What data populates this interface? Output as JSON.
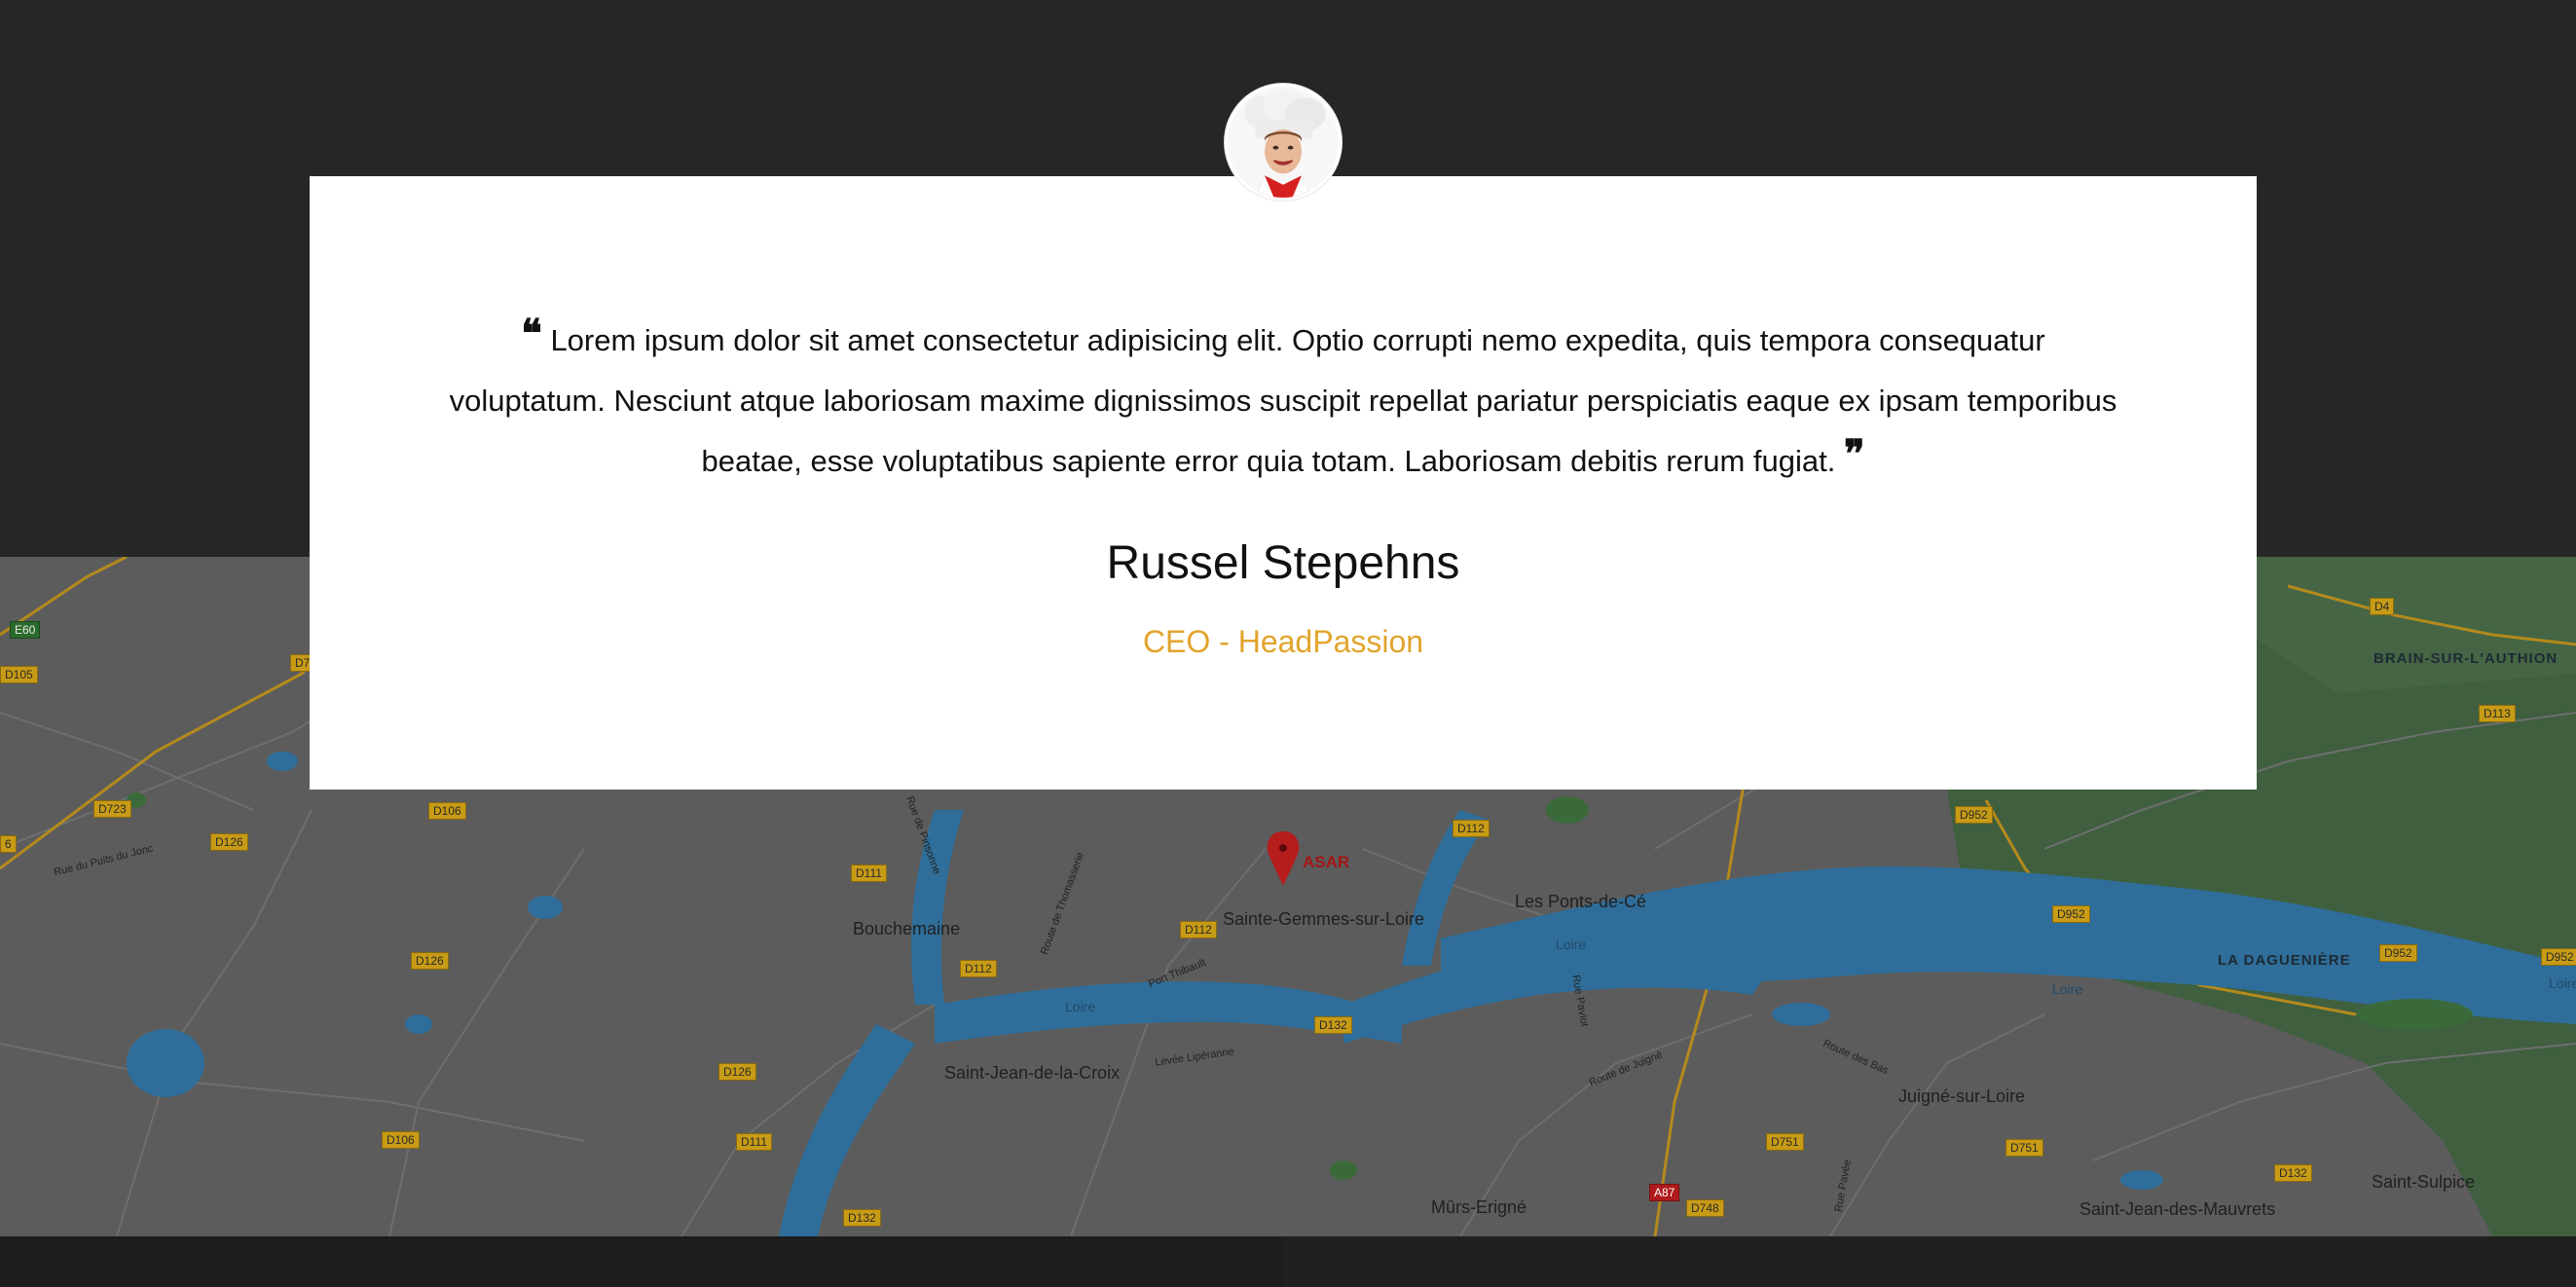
{
  "testimonial": {
    "quote": "Lorem ipsum dolor sit amet consectetur adipisicing elit. Optio corrupti nemo expedita, quis tempora consequatur voluptatum. Nesciunt atque laboriosam maxime dignissimos suscipit repellat pariatur perspiciatis eaque ex ipsam temporibus beatae, esse voluptatibus sapiente error quia totam. Laboriosam debitis rerum fugiat.",
    "open_quote_mark": "❝",
    "close_quote_mark": "❞",
    "name": "Russel Stepehns",
    "role": "CEO - HeadPassion",
    "accent_color": "#e2a42c"
  },
  "map": {
    "marker_label": "ASAR",
    "places": {
      "bouchemaine": "Bouchemaine",
      "sainte_gemmes": "Sainte-Gemmes-sur-Loire",
      "les_ponts_de_ce": "Les Ponts-de-Cé",
      "saint_jean": "Saint-Jean-de-la-Croix",
      "murs_erigne": "Mûrs-Erigné",
      "juigne": "Juigné-sur-Loire",
      "saint_jean_mauvrets": "Saint-Jean-des-Mauvrets",
      "saint_sulpice": "Saint-Sulpice",
      "brain": "BRAIN-SUR-L'AUTHION",
      "daguen": "LA DAGUENIÈRE"
    },
    "water_labels": {
      "loire_1": "Loire",
      "loire_2": "Loire",
      "loire_3": "Loire",
      "loire_4": "Loire"
    },
    "road_labels": {
      "rue_puits": "Rue du Puits du Jonc",
      "rue_pinsonne": "Rue de Pinsonne",
      "route_thomasserie": "Route de Thomasserie",
      "port_thibault": "Port Thibault",
      "levee": "Levée Lipéranne",
      "rue_paviot": "Rue Paviot",
      "route_juigne": "Route de Juigné",
      "route_bas": "Route des Bas",
      "rue_pavee": "Rue Pavée"
    },
    "shields": {
      "e60": "E60",
      "d105": "D105",
      "d723": "D723",
      "d106a": "D106",
      "d126a": "D126",
      "d126b": "D126",
      "d126c": "D126",
      "d106b": "D106",
      "d111a": "D111",
      "d111b": "D111",
      "d112a": "D112",
      "d112b": "D112",
      "d112c": "D112",
      "d132a": "D132",
      "d132b": "D132",
      "d132c": "D132",
      "d952a": "D952",
      "d952b": "D952",
      "d952c": "D952",
      "d952d": "D952",
      "d751a": "D751",
      "d751b": "D751",
      "d748": "D748",
      "a87": "A87",
      "d4": "D4",
      "d113": "D113",
      "d7": "D7",
      "d6": "6"
    }
  }
}
